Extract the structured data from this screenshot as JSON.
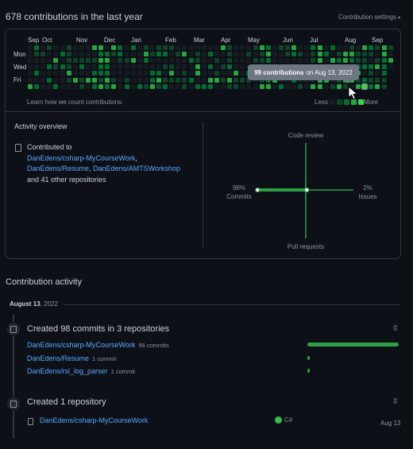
{
  "header": {
    "title": "678 contributions in the last year",
    "settings_label": "Contribution settings"
  },
  "calendar": {
    "months": [
      "Sep",
      "Oct",
      "Nov",
      "Dec",
      "Jan",
      "Feb",
      "Mar",
      "Apr",
      "May",
      "Jun",
      "Jul",
      "Aug",
      "Sep"
    ],
    "days": [
      "Mon",
      "Wed",
      "Fri"
    ],
    "learn_link": "Learn how we count contributions",
    "legend_less": "Less",
    "legend_more": "More",
    "colors": [
      "#161b22",
      "#0e4429",
      "#006d32",
      "#26a641",
      "#39d353"
    ],
    "tooltip": {
      "bold": "99 contributions",
      "rest": "on Aug 13, 2022"
    }
  },
  "overview": {
    "title": "Activity overview",
    "contributed_to": "Contributed to",
    "repos": [
      "DanEdens/csharp-MyCourseWork",
      "DanEdens/Resume",
      "DanEdens/AMTSWorkshop"
    ],
    "comma": ",",
    "other": "and 41 other repositories",
    "graph": {
      "top": "Code review",
      "bottom": "Pull requests",
      "left_pct": "98%",
      "left_label": "Commits",
      "right_pct": "2%",
      "right_label": "Issues",
      "commits_value": 98,
      "issues_value": 2
    }
  },
  "activity": {
    "title": "Contribution activity",
    "date_bold": "August 13",
    "date_rest": ", 2022",
    "commits_block": {
      "title": "Created 98 commits in 3 repositories",
      "rows": [
        {
          "repo": "DanEdens/csharp-MyCourseWork",
          "count": "96 commits",
          "value": 96
        },
        {
          "repo": "DanEdens/Resume",
          "count": "1 commit",
          "value": 1
        },
        {
          "repo": "DanEdens/rsl_log_parser",
          "count": "1 commit",
          "value": 1
        }
      ]
    },
    "repo_block": {
      "title": "Created 1 repository",
      "repo": "DanEdens/csharp-MyCourseWork",
      "language": "C#",
      "date": "Aug 13"
    }
  }
}
